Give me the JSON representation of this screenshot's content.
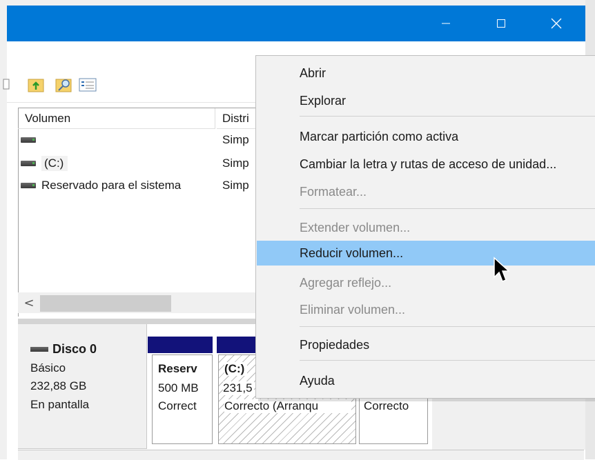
{
  "window": {
    "controls": {
      "minimize_icon": "minimize-icon",
      "maximize_icon": "maximize-icon",
      "close_icon": "close-icon"
    },
    "accent": "#0078d7"
  },
  "toolbar": {
    "icons": [
      "properties-icon",
      "upload-folder-icon",
      "search-folder-icon",
      "checklist-icon"
    ]
  },
  "volume_list": {
    "columns": [
      "Volumen",
      "Distri"
    ],
    "rows": [
      {
        "name": "",
        "layout": "Simp"
      },
      {
        "name": "(C:)",
        "layout": "Simp"
      },
      {
        "name": "Reservado para el sistema",
        "layout": "Simp"
      }
    ],
    "scroll_left_label": "<"
  },
  "disk": {
    "title": "Disco 0",
    "type": "Básico",
    "size": "232,88 GB",
    "status": "En pantalla",
    "partitions": [
      {
        "name": "Reserv",
        "size": "500 MB",
        "status": "Correct"
      },
      {
        "name": "(C:)",
        "size": "231,5",
        "status": "Correcto (Arranqu"
      },
      {
        "name": "",
        "size": "",
        "status": "Correcto"
      }
    ],
    "partition_color": "#12127a"
  },
  "context_menu": {
    "items": [
      {
        "label": "Abrir",
        "enabled": true
      },
      {
        "label": "Explorar",
        "enabled": true
      },
      {
        "label": "Marcar partición como activa",
        "enabled": true
      },
      {
        "label": "Cambiar la letra y rutas de acceso de unidad...",
        "enabled": true
      },
      {
        "label": "Formatear...",
        "enabled": false
      },
      {
        "label": "Extender volumen...",
        "enabled": false
      },
      {
        "label": "Reducir volumen...",
        "enabled": true,
        "highlighted": true
      },
      {
        "label": "Agregar reflejo...",
        "enabled": false
      },
      {
        "label": "Eliminar volumen...",
        "enabled": false
      },
      {
        "label": "Propiedades",
        "enabled": true
      },
      {
        "label": "Ayuda",
        "enabled": true
      }
    ],
    "highlight_color": "#91c9f7"
  }
}
